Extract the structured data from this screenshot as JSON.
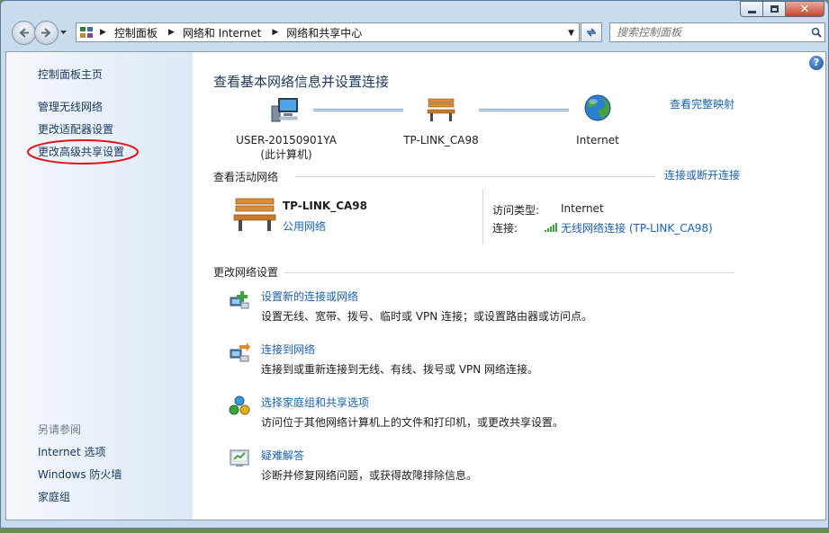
{
  "window": {
    "address": {
      "crumbs": [
        "控制面板",
        "网络和 Internet",
        "网络和共享中心"
      ]
    },
    "search": {
      "placeholder": "搜索控制面板"
    }
  },
  "sidebar": {
    "items": [
      {
        "label": "控制面板主页"
      },
      {
        "label": "管理无线网络"
      },
      {
        "label": "更改适配器设置"
      },
      {
        "label": "更改高级共享设置"
      }
    ],
    "see_also_heading": "另请参阅",
    "see_also": [
      {
        "label": "Internet 选项"
      },
      {
        "label": "Windows 防火墙"
      },
      {
        "label": "家庭组"
      }
    ]
  },
  "main": {
    "title": "查看基本网络信息并设置连接",
    "full_map": "查看完整映射",
    "nodes": {
      "computer": {
        "name": "USER-20150901YA",
        "sub": "(此计算机)",
        "icon": "computer-icon"
      },
      "network": {
        "name": "TP-LINK_CA98",
        "icon": "bench-icon"
      },
      "internet": {
        "name": "Internet",
        "icon": "globe-icon"
      }
    },
    "active_heading": "查看活动网络",
    "connect_toggle": "连接或断开连接",
    "active": {
      "name": "TP-LINK_CA98",
      "type": "公用网络",
      "access_label": "访问类型:",
      "access_value": "Internet",
      "connection_label": "连接:",
      "connection_value": "无线网络连接 (TP-LINK_CA98)"
    },
    "change_heading": "更改网络设置",
    "tasks": [
      {
        "title": "设置新的连接或网络",
        "desc": "设置无线、宽带、拨号、临时或 VPN 连接；或设置路由器或访问点。",
        "icon": "new-connection-icon"
      },
      {
        "title": "连接到网络",
        "desc": "连接到或重新连接到无线、有线、拨号或 VPN 网络连接。",
        "icon": "connect-network-icon"
      },
      {
        "title": "选择家庭组和共享选项",
        "desc": "访问位于其他网络计算机上的文件和打印机，或更改共享设置。",
        "icon": "homegroup-icon"
      },
      {
        "title": "疑难解答",
        "desc": "诊断并修复网络问题，或获得故障排除信息。",
        "icon": "troubleshoot-icon"
      }
    ]
  },
  "colors": {
    "link": "#1a61b5",
    "title": "#1e395b",
    "annotation_circle": "#e0141b",
    "sidebar_bg": "#dde9f5"
  }
}
